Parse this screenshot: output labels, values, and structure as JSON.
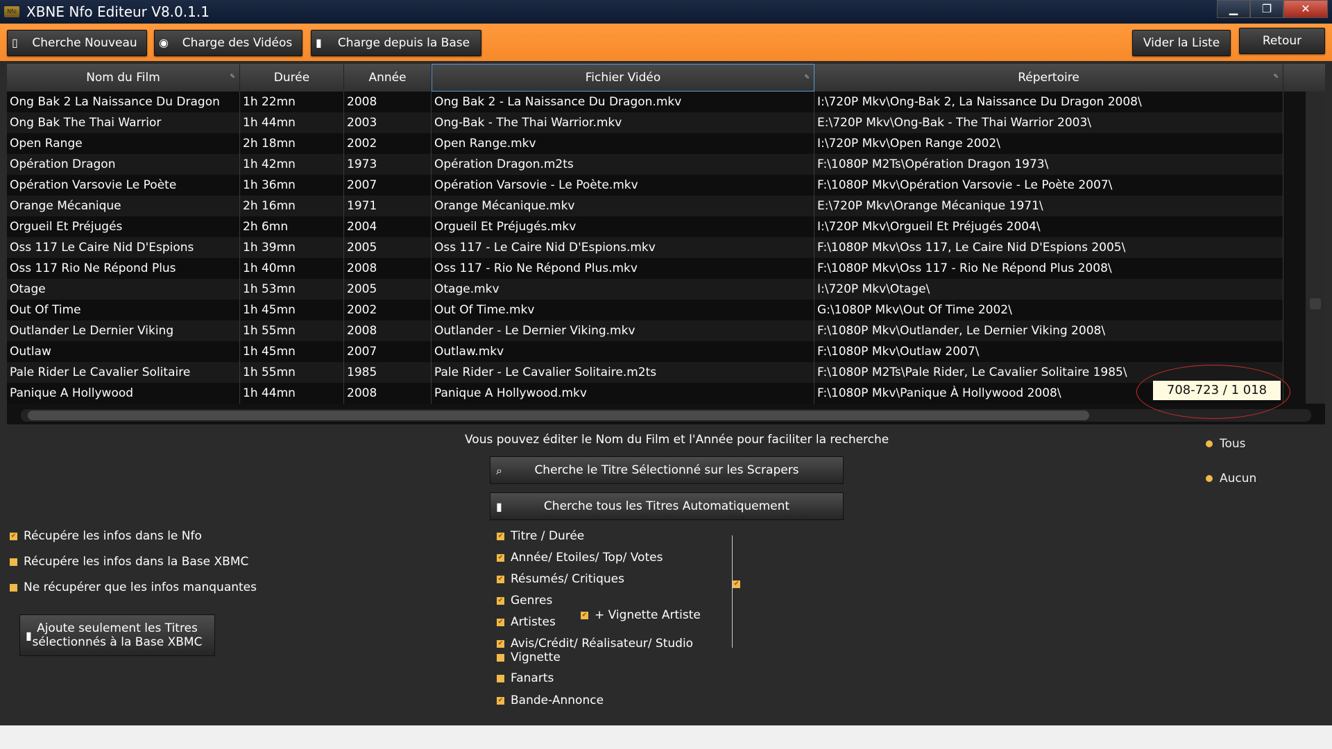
{
  "window": {
    "title": "XBNE Nfo Editeur V8.0.1.1",
    "app_icon": "Nfo",
    "controls": {
      "minimize": "▁",
      "restore": "❐",
      "close": "✕"
    }
  },
  "toolbar": {
    "search_new": "Cherche Nouveau",
    "load_videos": "Charge des Vidéos",
    "load_from_db": "Charge depuis la Base",
    "clear_list": "Vider la Liste",
    "back": "Retour"
  },
  "grid": {
    "columns": [
      "Nom du Film",
      "Durée",
      "Année",
      "Fichier Vidéo",
      "Répertoire"
    ],
    "rows": [
      [
        "Ong Bak 2 La Naissance Du Dragon",
        "1h 22mn",
        "2008",
        "Ong Bak 2 - La Naissance Du Dragon.mkv",
        "I:\\720P Mkv\\Ong-Bak 2, La Naissance Du Dragon 2008\\"
      ],
      [
        "Ong Bak The Thai Warrior",
        "1h 44mn",
        "2003",
        "Ong-Bak - The Thai Warrior.mkv",
        "E:\\720P Mkv\\Ong-Bak - The Thai Warrior 2003\\"
      ],
      [
        "Open Range",
        "2h 18mn",
        "2002",
        "Open Range.mkv",
        "I:\\720P Mkv\\Open Range 2002\\"
      ],
      [
        "Opération Dragon",
        "1h 42mn",
        "1973",
        "Opération Dragon.m2ts",
        "F:\\1080P M2Ts\\Opération Dragon 1973\\"
      ],
      [
        "Opération Varsovie Le Poète",
        "1h 36mn",
        "2007",
        "Opération Varsovie - Le Poète.mkv",
        "F:\\1080P Mkv\\Opération Varsovie - Le Poète 2007\\"
      ],
      [
        "Orange Mécanique",
        "2h 16mn",
        "1971",
        "Orange Mécanique.mkv",
        "E:\\720P Mkv\\Orange Mécanique 1971\\"
      ],
      [
        "Orgueil Et Préjugés",
        "2h 6mn",
        "2004",
        "Orgueil Et Préjugés.mkv",
        "I:\\720P Mkv\\Orgueil Et Préjugés 2004\\"
      ],
      [
        "Oss 117 Le Caire Nid D'Espions",
        "1h 39mn",
        "2005",
        "Oss 117 - Le Caire Nid D'Espions.mkv",
        "F:\\1080P Mkv\\Oss 117, Le Caire Nid D'Espions 2005\\"
      ],
      [
        "Oss 117 Rio Ne Répond Plus",
        "1h 40mn",
        "2008",
        "Oss 117 - Rio Ne Répond Plus.mkv",
        "F:\\1080P Mkv\\Oss 117 - Rio Ne Répond Plus 2008\\"
      ],
      [
        "Otage",
        "1h 53mn",
        "2005",
        "Otage.mkv",
        "I:\\720P Mkv\\Otage\\"
      ],
      [
        "Out Of Time",
        "1h 45mn",
        "2002",
        "Out Of Time.mkv",
        "G:\\1080P Mkv\\Out Of Time 2002\\"
      ],
      [
        "Outlander Le Dernier Viking",
        "1h 55mn",
        "2008",
        "Outlander - Le Dernier Viking.mkv",
        "F:\\1080P Mkv\\Outlander, Le Dernier Viking 2008\\"
      ],
      [
        "Outlaw",
        "1h 45mn",
        "2007",
        "Outlaw.mkv",
        "F:\\1080P Mkv\\Outlaw 2007\\"
      ],
      [
        "Pale Rider Le Cavalier Solitaire",
        "1h 55mn",
        "1985",
        "Pale Rider - Le Cavalier Solitaire.m2ts",
        "F:\\1080P M2Ts\\Pale Rider, Le Cavalier Solitaire 1985\\"
      ],
      [
        "Panique A Hollywood",
        "1h 44mn",
        "2008",
        "Panique A Hollywood.mkv",
        "F:\\1080P Mkv\\Panique À Hollywood 2008\\"
      ]
    ],
    "counter": "708-723 / 1 018"
  },
  "panel": {
    "hint": "Vous pouvez éditer le Nom du Film et l'Année pour faciliter la recherche",
    "search_selected": "Cherche le Titre Sélectionné sur les Scrapers",
    "search_all": "Cherche tous les Titres Automatiquement",
    "radio_all": "Tous",
    "radio_none": "Aucun",
    "left_options": [
      {
        "label": "Récupére les infos dans le Nfo",
        "checked": true
      },
      {
        "label": "Récupére les infos dans la Base XBMC",
        "checked": false
      },
      {
        "label": "Ne récupérer que les infos manquantes",
        "checked": false
      }
    ],
    "add_selected_line1": "Ajoute seulement les Titres",
    "add_selected_line2": "sélectionnés à la Base XBMC",
    "fields": [
      {
        "label": "Titre / Durée",
        "checked": true
      },
      {
        "label": "Année/ Etoiles/ Top/ Votes",
        "checked": true
      },
      {
        "label": "Résumés/ Critiques",
        "checked": true
      },
      {
        "label": "Genres",
        "checked": true
      },
      {
        "label": "Artistes",
        "checked": true
      },
      {
        "label": "Avis/Crédit/ Réalisateur/ Studio",
        "checked": true
      },
      {
        "label": "Vignette",
        "checked": false
      },
      {
        "label": "Fanarts",
        "checked": false
      },
      {
        "label": "Bande-Annonce",
        "checked": true
      }
    ],
    "artist_thumb": {
      "label": "+ Vignette Artiste",
      "checked": true
    },
    "check_mark": "✔"
  },
  "colors": {
    "toolbar": "#f7892a",
    "checkbox": "#f0b94a",
    "counter_ring": "#d12b2b"
  }
}
